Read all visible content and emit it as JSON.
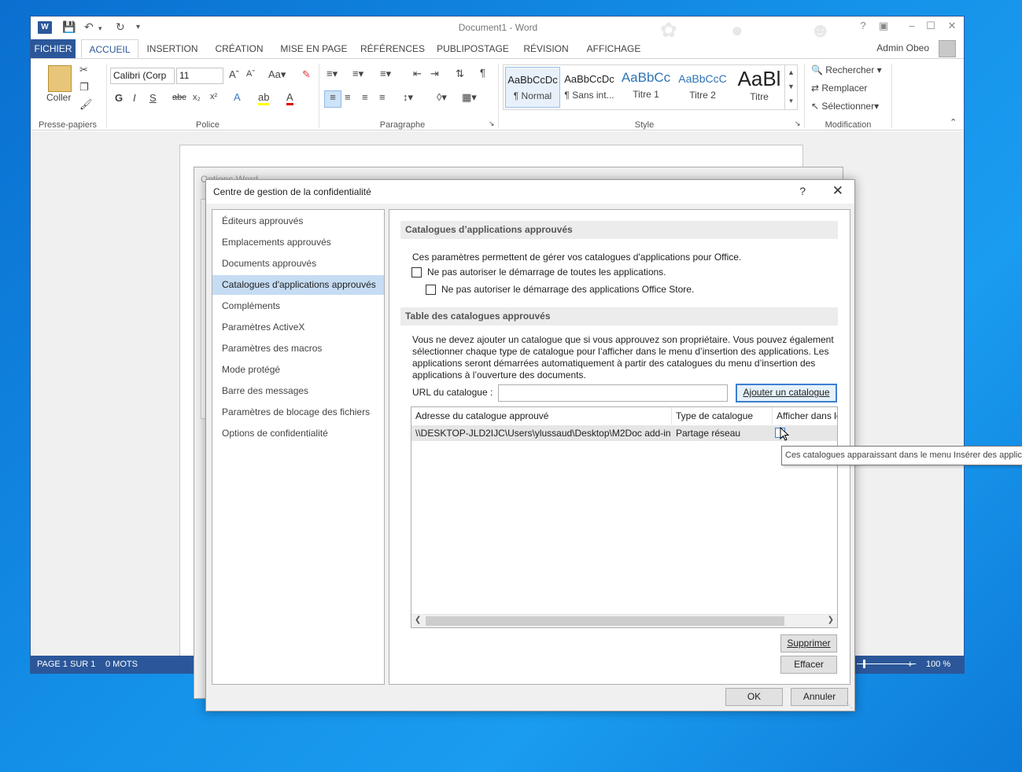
{
  "word": {
    "title": "Document1 - Word",
    "logo": "W",
    "help": "?",
    "user": "Admin Obeo",
    "tabs": [
      "FICHIER",
      "ACCUEIL",
      "INSERTION",
      "CRÉATION",
      "MISE EN PAGE",
      "RÉFÉRENCES",
      "PUBLIPOSTAGE",
      "RÉVISION",
      "AFFICHAGE"
    ],
    "ribbon": {
      "paste_label": "Coller",
      "font_name": "Calibri (Corp",
      "font_size": "11",
      "styles": [
        {
          "sample": "AaBbCcDc",
          "name": "¶ Normal"
        },
        {
          "sample": "AaBbCcDc",
          "name": "¶ Sans int..."
        },
        {
          "sample": "AaBbCc",
          "name": "Titre 1"
        },
        {
          "sample": "AaBbCcC",
          "name": "Titre 2"
        },
        {
          "sample": "AaBl",
          "name": "Titre"
        }
      ],
      "find": "Rechercher",
      "replace": "Remplacer",
      "select": "Sélectionner",
      "groups": [
        "Presse-papiers",
        "Police",
        "Paragraphe",
        "Style",
        "Modification"
      ]
    },
    "status": {
      "page": "PAGE 1 SUR 1",
      "words": "0 MOTS",
      "zoom": "100 %"
    }
  },
  "options_dialog": {
    "title": "Options Word"
  },
  "trust_center": {
    "title": "Centre de gestion de la confidentialité",
    "help": "?",
    "nav": [
      "Éditeurs approuvés",
      "Emplacements approuvés",
      "Documents approuvés",
      "Catalogues d'applications approuvés",
      "Compléments",
      "Paramètres ActiveX",
      "Paramètres des macros",
      "Mode protégé",
      "Barre des messages",
      "Paramètres de blocage des fichiers",
      "Options de confidentialité"
    ],
    "selected_nav": 3,
    "section1_title": "Catalogues d’applications approuvés",
    "section1_desc": "Ces paramètres permettent de gérer vos catalogues d'applications pour Office.",
    "check1": "Ne pas autoriser le démarrage de toutes les applications.",
    "check2": "Ne pas autoriser le démarrage des applications Office Store.",
    "section2_title": "Table des catalogues approuvés",
    "section2_desc": [
      "Vous ne devez ajouter un catalogue que si vous approuvez son propriétaire. Vous pouvez également",
      "sélectionner chaque type de catalogue pour l’afficher dans le menu d’insertion des applications. Les",
      "applications seront démarrées automatiquement à partir des catalogues du menu d’insertion des",
      "applications à l’ouverture des documents."
    ],
    "url_label": "URL du catalogue :",
    "url_value": "",
    "add_button": "Ajouter un catalogue",
    "columns": [
      "Adresse du catalogue approuvé",
      "Type de catalogue",
      "Afficher dans le menu"
    ],
    "rows": [
      {
        "address": "\\\\DESKTOP-JLD2IJC\\Users\\ylussaud\\Desktop\\M2Doc add-in",
        "type": "Partage réseau",
        "show": false
      }
    ],
    "delete_button": "Supprimer",
    "clear_button": "Effacer",
    "ok_button": "OK",
    "cancel_button": "Annuler",
    "tooltip": "Ces catalogues apparaissant dans le menu Insérer des applications"
  }
}
